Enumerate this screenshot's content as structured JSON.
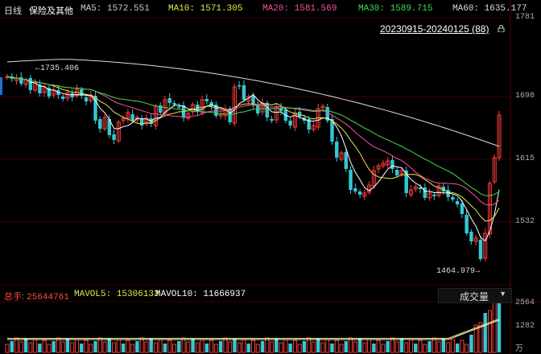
{
  "header": {
    "period": "日线",
    "name": "保险及其他",
    "ma": [
      {
        "label": "MA5:",
        "value": "1572.551",
        "color": "#ffffff"
      },
      {
        "label": "MA10:",
        "value": "1571.305",
        "color": "#e6e64c"
      },
      {
        "label": "MA20:",
        "value": "1581.569",
        "color": "#ff4fa3"
      },
      {
        "label": "MA30:",
        "value": "1589.715",
        "color": "#3ddc4e"
      },
      {
        "label": "MA60:",
        "value": "1635.177",
        "color": "#dddddd"
      }
    ]
  },
  "range_label": "20230915-20240125 (88)",
  "lock_icon": "lock-icon",
  "price_axis": {
    "labels": [
      "1781",
      "1698",
      "1615",
      "1532"
    ],
    "max": "1781",
    "min": "1464.979"
  },
  "annotations": {
    "high": "1735.406",
    "low": "1464.979"
  },
  "volume": {
    "total_label": "总手:",
    "total_value": "25644761",
    "mavol5_label": "MAVOL5:",
    "mavol5_value": "15306133",
    "mavol10_label": "MAVOL10:",
    "mavol10_value": "11666937",
    "axis": [
      "2564",
      "1282"
    ],
    "unit": "万",
    "selector": "成交量"
  },
  "colors": {
    "up": "#ff3b3b",
    "down": "#35c7d4",
    "grid": "#3a0000",
    "background": "#000000"
  }
}
